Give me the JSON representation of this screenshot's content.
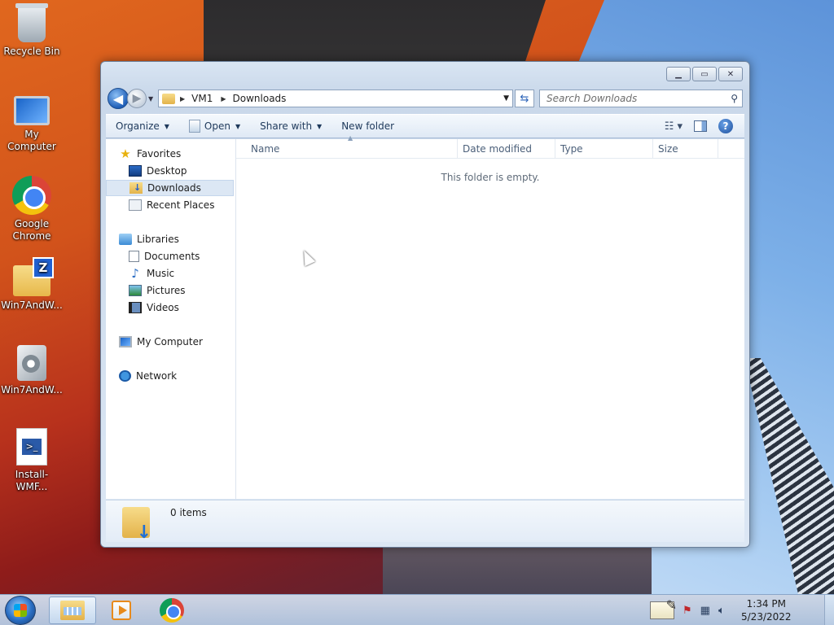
{
  "desktop": {
    "icons": [
      {
        "label": "Recycle Bin",
        "icon": "recycle-bin-icon"
      },
      {
        "label": "My Computer",
        "icon": "computer-icon"
      },
      {
        "label": "Google Chrome",
        "icon": "chrome-icon"
      },
      {
        "label": "Win7AndW...",
        "icon": "zip-folder-icon"
      },
      {
        "label": "Win7AndW...",
        "icon": "setup-icon"
      },
      {
        "label": "Install-WMF...",
        "icon": "powershell-script-icon"
      }
    ]
  },
  "explorer": {
    "breadcrumbs": [
      "VM1",
      "Downloads"
    ],
    "search_placeholder": "Search Downloads",
    "toolbar": {
      "organize": "Organize",
      "open": "Open",
      "share_with": "Share with",
      "new_folder": "New folder"
    },
    "nav": {
      "favorites": "Favorites",
      "desktop": "Desktop",
      "downloads": "Downloads",
      "recent_places": "Recent Places",
      "libraries": "Libraries",
      "documents": "Documents",
      "music": "Music",
      "pictures": "Pictures",
      "videos": "Videos",
      "my_computer": "My Computer",
      "network": "Network"
    },
    "columns": [
      "Name",
      "Date modified",
      "Type",
      "Size"
    ],
    "empty_message": "This folder is empty.",
    "item_count": "0 items"
  },
  "taskbar": {
    "time": "1:34 PM",
    "date": "5/23/2022"
  }
}
